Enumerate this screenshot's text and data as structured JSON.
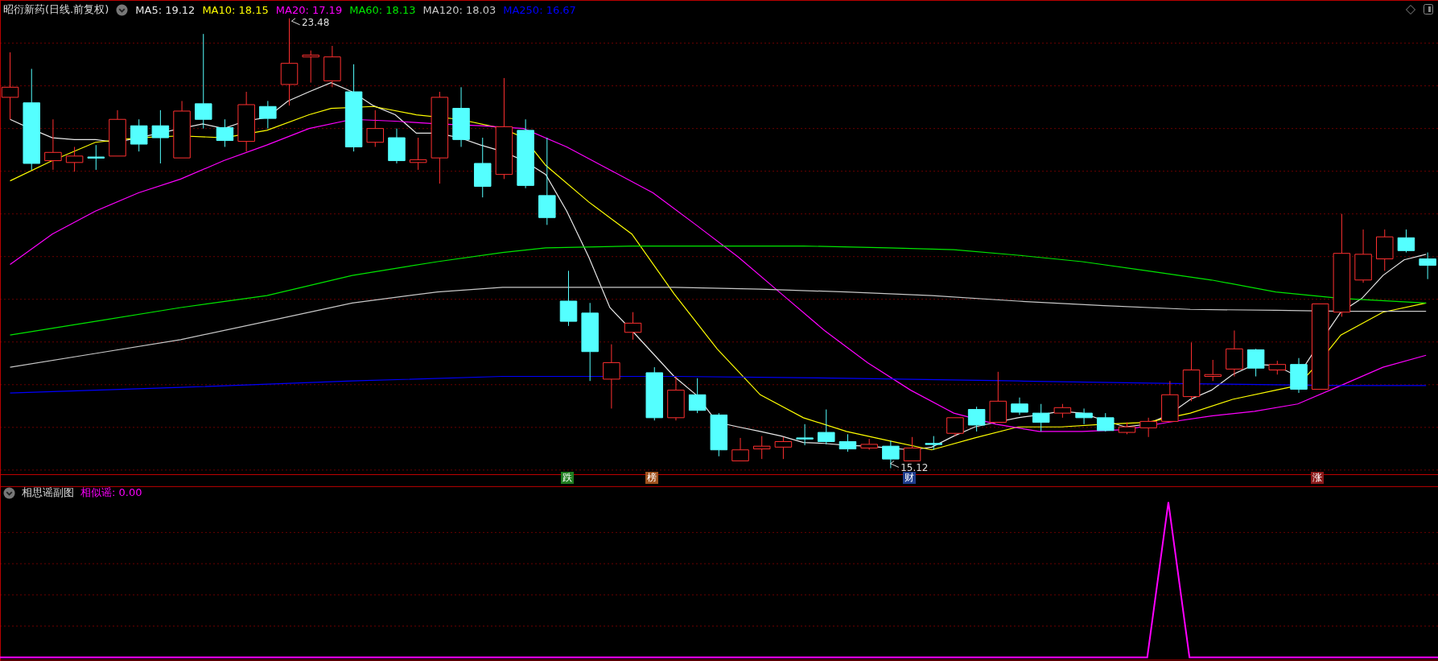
{
  "title": {
    "name": "昭衍新药(日线.前复权)"
  },
  "ma_legend": [
    {
      "label": "MA5: 19.12",
      "color": "#e8e8e8"
    },
    {
      "label": "MA10: 18.15",
      "color": "#ffff00"
    },
    {
      "label": "MA20: 17.19",
      "color": "#ff00ff"
    },
    {
      "label": "MA60: 18.13",
      "color": "#00e600"
    },
    {
      "label": "MA120: 18.03",
      "color": "#c8c8c8"
    },
    {
      "label": "MA250: 16.67",
      "color": "#0000ff"
    }
  ],
  "price_labels": [
    {
      "kind": "high",
      "text": "23.48"
    },
    {
      "kind": "low",
      "text": "15.12"
    }
  ],
  "signals": [
    {
      "text": "跌",
      "color": "#1f7d1f"
    },
    {
      "text": "榜",
      "color": "#a0521e"
    },
    {
      "text": "财",
      "color": "#1e3c8c"
    },
    {
      "text": "涨",
      "color": "#8c1a1a"
    }
  ],
  "sub_chart": {
    "title": "相思谣副图",
    "indicator": "相似谣: 0.00"
  }
}
